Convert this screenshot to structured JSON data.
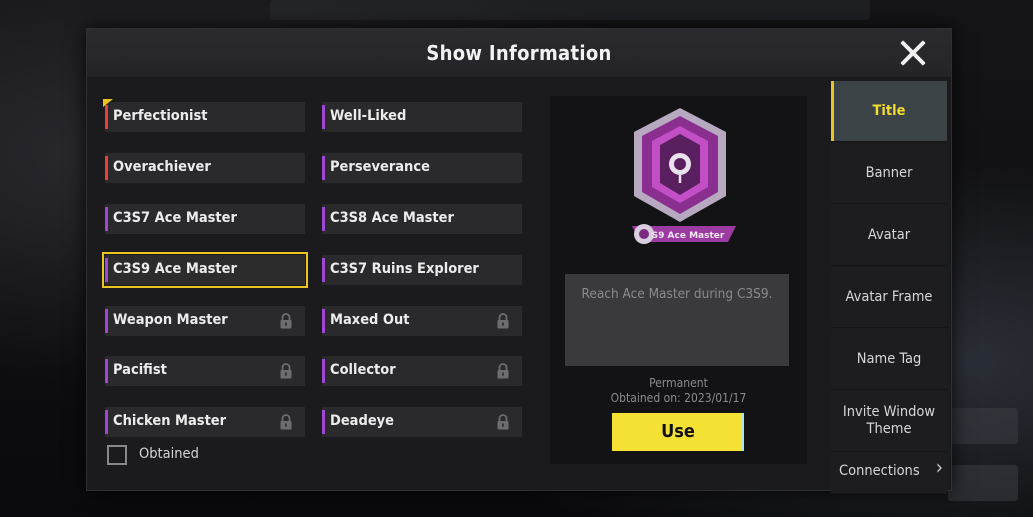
{
  "dialog": {
    "title": "Show Information"
  },
  "titles": [
    {
      "label": "Perfectionist",
      "bar": "#e5433a",
      "locked": false,
      "selected": false,
      "tick": true
    },
    {
      "label": "Well-Liked",
      "bar": "#a246d8",
      "locked": false,
      "selected": false
    },
    {
      "label": "Overachiever",
      "bar": "#e5433a",
      "locked": false,
      "selected": false
    },
    {
      "label": "Perseverance",
      "bar": "#a246d8",
      "locked": false,
      "selected": false
    },
    {
      "label": "C3S7 Ace Master",
      "bar": "#a246d8",
      "locked": false,
      "selected": false
    },
    {
      "label": "C3S8 Ace Master",
      "bar": "#a246d8",
      "locked": false,
      "selected": false
    },
    {
      "label": "C3S9 Ace Master",
      "bar": "#a246d8",
      "locked": false,
      "selected": true
    },
    {
      "label": "C3S7 Ruins Explorer",
      "bar": "#a246d8",
      "locked": false,
      "selected": false
    },
    {
      "label": "Weapon Master",
      "bar": "#a246d8",
      "locked": true,
      "selected": false
    },
    {
      "label": "Maxed Out",
      "bar": "#a246d8",
      "locked": true,
      "selected": false
    },
    {
      "label": "Pacifist",
      "bar": "#a246d8",
      "locked": true,
      "selected": false
    },
    {
      "label": "Collector",
      "bar": "#a246d8",
      "locked": true,
      "selected": false
    },
    {
      "label": "Chicken Master",
      "bar": "#a246d8",
      "locked": true,
      "selected": false
    },
    {
      "label": "Deadeye",
      "bar": "#a246d8",
      "locked": true,
      "selected": false
    }
  ],
  "filter": {
    "obtained_label": "Obtained",
    "checked": false
  },
  "detail": {
    "badge_label": "S9 Ace Master",
    "description": "Reach Ace Master during C3S9.",
    "permanence": "Permanent",
    "obtained_on": "Obtained on: 2023/01/17",
    "use_label": "Use"
  },
  "tabs": [
    {
      "label": "Title",
      "active": true
    },
    {
      "label": "Banner",
      "active": false
    },
    {
      "label": "Avatar",
      "active": false
    },
    {
      "label": "Avatar Frame",
      "active": false
    },
    {
      "label": "Name Tag",
      "active": false
    },
    {
      "label": "Invite Window Theme",
      "active": false
    },
    {
      "label": "Connections",
      "active": false
    }
  ],
  "colors": {
    "accent_yellow": "#e8c520",
    "use_button": "#f5e034",
    "epic_purple": "#a246d8",
    "legendary_red": "#e5433a"
  },
  "icons": {
    "lock": "lock-icon",
    "close": "close-icon",
    "chevron": "chevron-right-icon",
    "badge": "ace-master-badge-icon"
  }
}
